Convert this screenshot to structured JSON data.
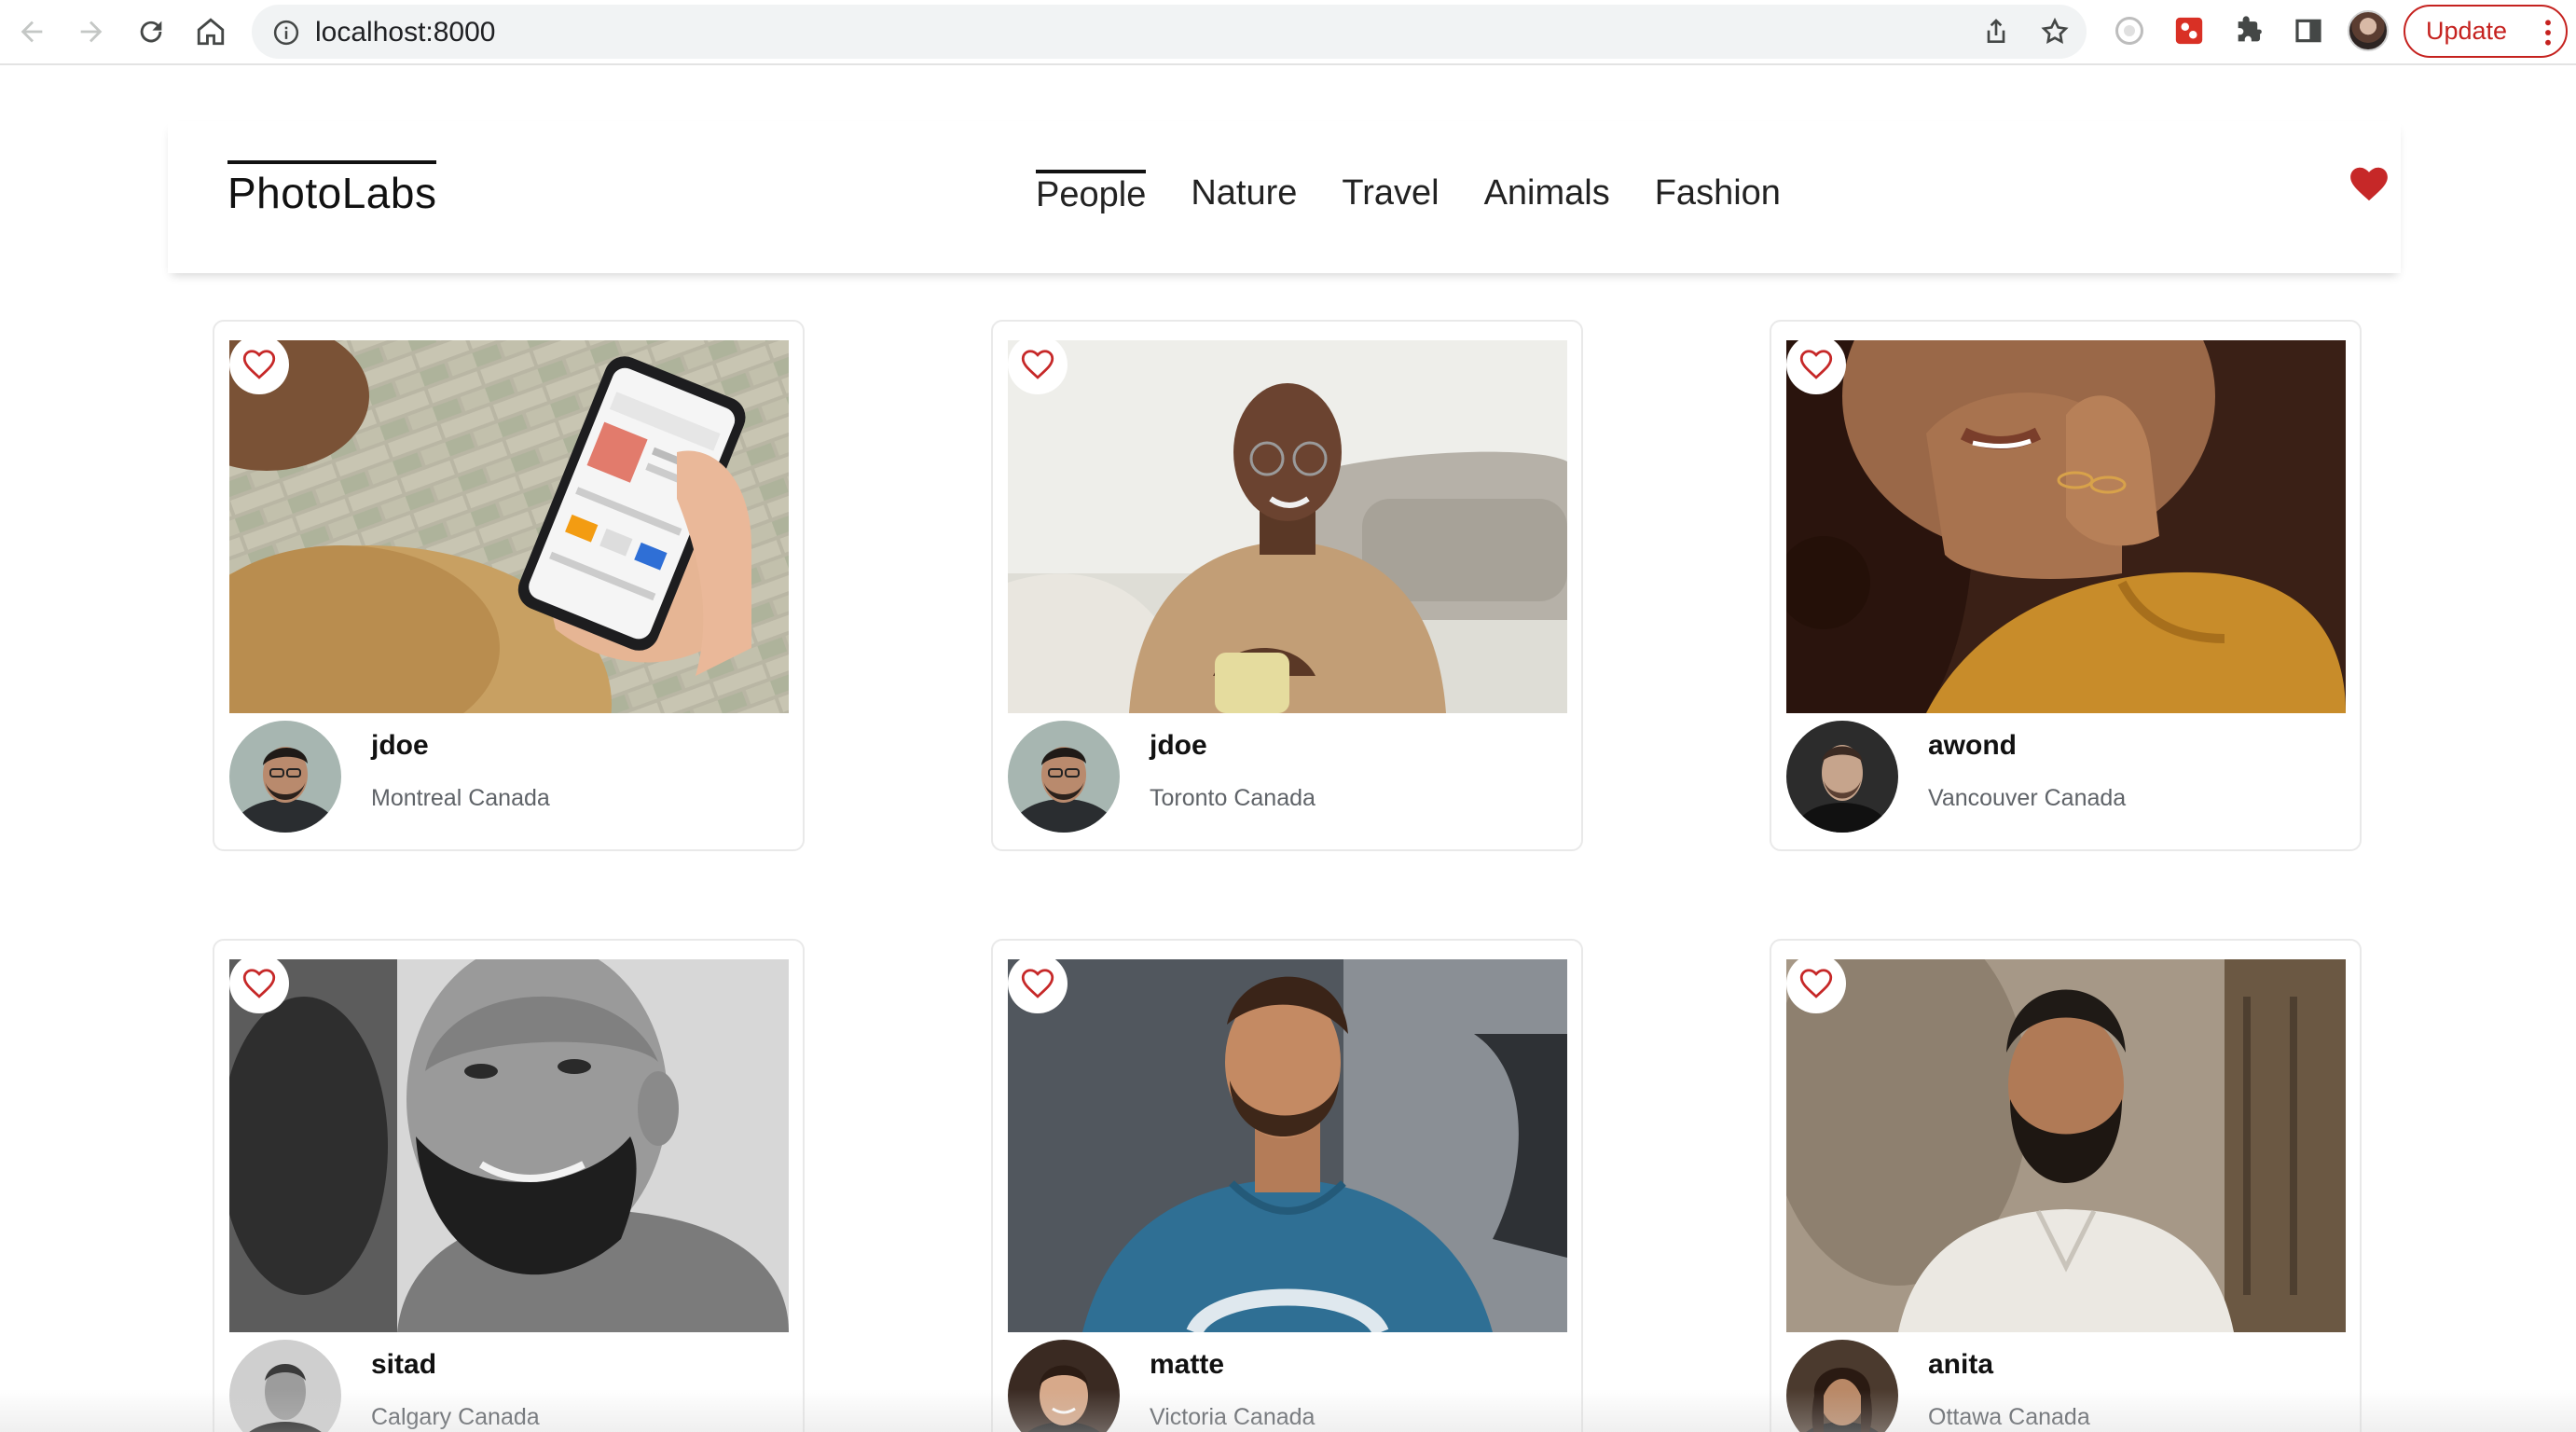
{
  "browser": {
    "url": "localhost:8000",
    "update_label": "Update"
  },
  "app": {
    "logo": "PhotoLabs",
    "topics": [
      "People",
      "Nature",
      "Travel",
      "Animals",
      "Fashion"
    ],
    "active_topic": "People"
  },
  "photos": [
    {
      "username": "jdoe",
      "location": "Montreal Canada",
      "favourited": false,
      "photo": "hand holding phone showing app"
    },
    {
      "username": "jdoe",
      "location": "Toronto Canada",
      "favourited": false,
      "photo": "man in turtleneck with mug on sofa"
    },
    {
      "username": "awond",
      "location": "Vancouver Canada",
      "favourited": false,
      "photo": "woman with curly hair, hand on cheek"
    },
    {
      "username": "sitad",
      "location": "Calgary Canada",
      "favourited": false,
      "photo": "black and white portrait of bearded man"
    },
    {
      "username": "matte",
      "location": "Victoria Canada",
      "favourited": false,
      "photo": "man in blue t-shirt looking up"
    },
    {
      "username": "anita",
      "location": "Ottawa Canada",
      "favourited": false,
      "photo": "bearded man in white shirt against wall"
    }
  ],
  "colors": {
    "heart": "#c62828",
    "update": "#c5221f",
    "text_primary": "#111111",
    "text_secondary": "#5f6368"
  }
}
